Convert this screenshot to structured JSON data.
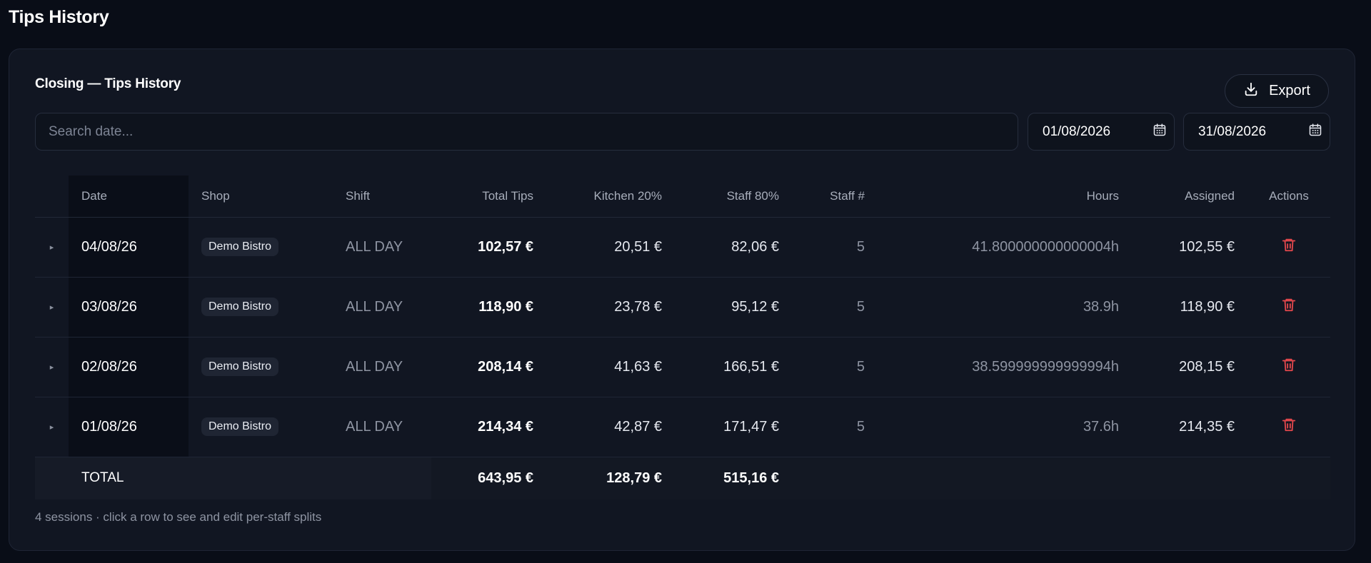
{
  "page": {
    "title": "Tips History"
  },
  "card": {
    "title": "Closing — Tips History",
    "export_label": "Export",
    "search_placeholder": "Search date...",
    "date_from": "01/08/2026",
    "date_to": "31/08/2026"
  },
  "table": {
    "headers": {
      "date": "Date",
      "shop": "Shop",
      "shift": "Shift",
      "total_tips": "Total Tips",
      "kitchen": "Kitchen 20%",
      "staff": "Staff 80%",
      "staff_count": "Staff #",
      "hours": "Hours",
      "assigned": "Assigned",
      "actions": "Actions"
    },
    "rows": [
      {
        "expander": "▸",
        "date": "04/08/26",
        "shop": "Demo Bistro",
        "shift": "ALL DAY",
        "total_tips": "102,57 €",
        "kitchen": "20,51 €",
        "staff": "82,06 €",
        "staff_count": "5",
        "hours": "41.800000000000004h",
        "assigned": "102,55 €"
      },
      {
        "expander": "▸",
        "date": "03/08/26",
        "shop": "Demo Bistro",
        "shift": "ALL DAY",
        "total_tips": "118,90 €",
        "kitchen": "23,78 €",
        "staff": "95,12 €",
        "staff_count": "5",
        "hours": "38.9h",
        "assigned": "118,90 €"
      },
      {
        "expander": "▸",
        "date": "02/08/26",
        "shop": "Demo Bistro",
        "shift": "ALL DAY",
        "total_tips": "208,14 €",
        "kitchen": "41,63 €",
        "staff": "166,51 €",
        "staff_count": "5",
        "hours": "38.599999999999994h",
        "assigned": "208,15 €"
      },
      {
        "expander": "▸",
        "date": "01/08/26",
        "shop": "Demo Bistro",
        "shift": "ALL DAY",
        "total_tips": "214,34 €",
        "kitchen": "42,87 €",
        "staff": "171,47 €",
        "staff_count": "5",
        "hours": "37.6h",
        "assigned": "214,35 €"
      }
    ],
    "total": {
      "label": "TOTAL",
      "total_tips": "643,95 €",
      "kitchen": "128,79 €",
      "staff": "515,16 €"
    }
  },
  "footnote": "4 sessions · click a row to see and edit per-staff splits",
  "icons": {
    "export": "download-icon",
    "calendar": "calendar-icon",
    "delete": "trash-icon",
    "expander": "caret-right-icon"
  },
  "colors": {
    "delete": "#e5484d",
    "background": "#090d17",
    "card": "#111622"
  }
}
